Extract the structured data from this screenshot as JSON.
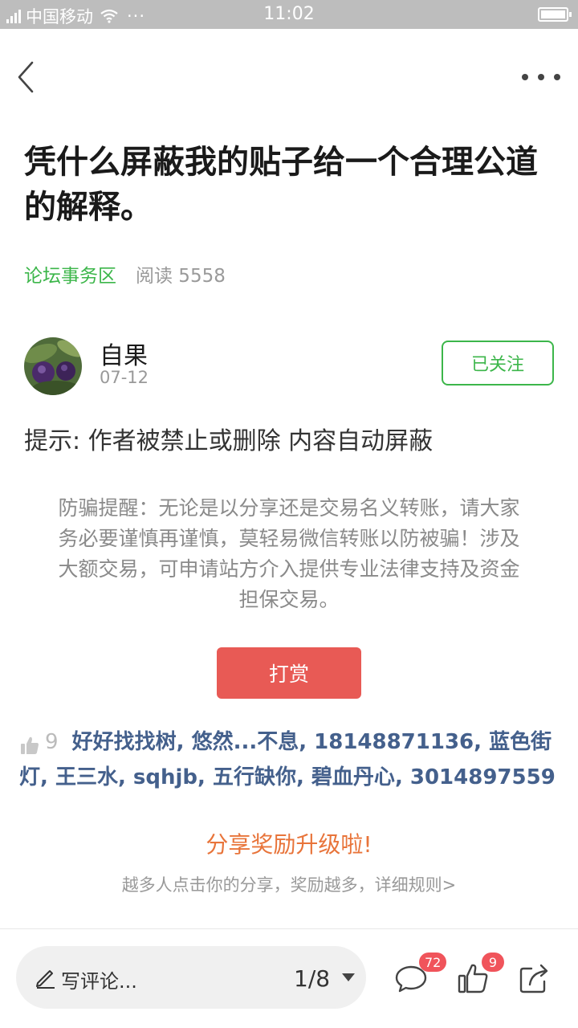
{
  "status_bar": {
    "network_type": "4G",
    "carrier": "中国移动",
    "extra": "···",
    "time": "11:02"
  },
  "nav": {
    "back_icon": "chevron-left-icon",
    "more_icon": "more-dots-icon"
  },
  "post": {
    "title": "凭什么屏蔽我的贴子给一个合理公道的解释。",
    "forum": "论坛事务区",
    "reads": "阅读 5558",
    "author": {
      "name": "自果",
      "date": "07-12",
      "follow_label": "已关注"
    },
    "notice": "提示: 作者被禁止或删除 内容自动屏蔽",
    "warning": "防骗提醒：无论是以分享还是交易名义转账，请大家务必要谨慎再谨慎，莫轻易微信转账以防被骗！涉及大额交易，可申请站方介入提供专业法律支持及资金担保交易。",
    "reward_label": "打赏",
    "like_count": "9",
    "likers": [
      "好好找找树",
      "悠然...不息",
      "18148871136",
      "蓝色街灯",
      "王三水",
      "sqhjb",
      "五行缺你",
      "碧血丹心",
      "3014897559"
    ]
  },
  "share": {
    "title": "分享奖励升级啦!",
    "subtitle": "越多人点击你的分享，奖励越多，详细规则>"
  },
  "bottom_bar": {
    "comment_placeholder": "写评论...",
    "page_indicator": "1/8",
    "comment_count": "72",
    "like_count": "9"
  },
  "colors": {
    "accent_green": "#3cb64a",
    "reward_red": "#e85a55",
    "share_orange": "#e8743a",
    "liker_blue": "#44608c",
    "badge_red": "#f0545b"
  }
}
